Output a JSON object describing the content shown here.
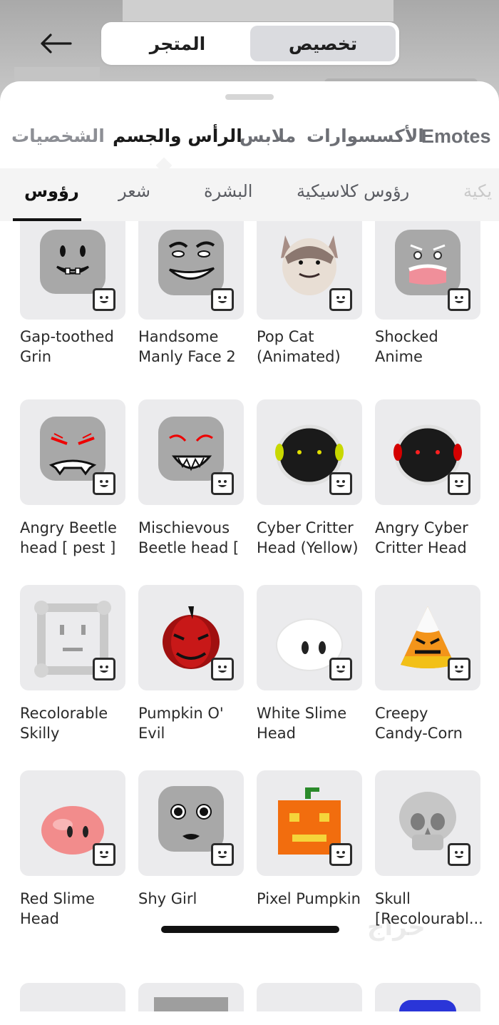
{
  "header": {
    "segments": [
      {
        "label": "تخصيص",
        "active": true
      },
      {
        "label": "المتجر",
        "active": false
      }
    ]
  },
  "category_tabs": [
    {
      "label": "Emotes",
      "active": false,
      "partial": true
    },
    {
      "label": "الأكسسوارات",
      "active": false
    },
    {
      "label": "ملابس",
      "active": false
    },
    {
      "label": "الرأس والجسم",
      "active": true
    },
    {
      "label": "الشخصيات",
      "active": false
    }
  ],
  "sub_tabs": [
    {
      "label": "يكية",
      "active": false,
      "partial": true
    },
    {
      "label": "رؤوس كلاسيكية",
      "active": false
    },
    {
      "label": "البشرة",
      "active": false
    },
    {
      "label": "شعر",
      "active": false
    },
    {
      "label": "رؤوس",
      "active": true
    }
  ],
  "items": [
    {
      "name": "Gap-toothed\nGrin"
    },
    {
      "name": "Handsome\nManly Face 2"
    },
    {
      "name": "Pop Cat\n(Animated)"
    },
    {
      "name": "Shocked\nAnime"
    },
    {
      "name": "Angry Beetle\nhead [ pest ]"
    },
    {
      "name": "Mischievous\nBeetle head ["
    },
    {
      "name": "Cyber Critter\nHead (Yellow)"
    },
    {
      "name": "Angry Cyber\nCritter Head"
    },
    {
      "name": "Recolorable\nSkilly"
    },
    {
      "name": "Pumpkin O'\nEvil"
    },
    {
      "name": "White Slime\nHead"
    },
    {
      "name": "Creepy\nCandy-Corn"
    },
    {
      "name": "Red Slime\nHead"
    },
    {
      "name": "Shy Girl"
    },
    {
      "name": "Pixel Pumpkin"
    },
    {
      "name": "Skull\n[Recolourabl..."
    }
  ],
  "watermark": "حراج",
  "colors": {
    "active_segment": "#dadbdf",
    "card_bg": "#ebebed",
    "sheet_bg": "#ffffff"
  }
}
